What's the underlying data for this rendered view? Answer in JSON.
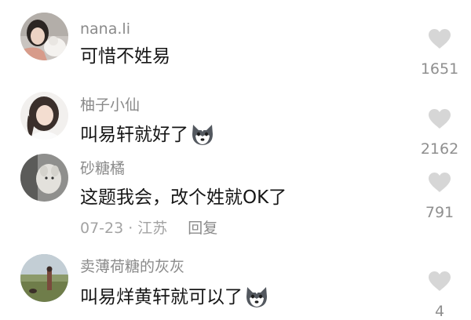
{
  "comments": [
    {
      "username": "nana.li",
      "text": "可惜不姓易",
      "likes": "1651",
      "avatar": "girl-with-cat-avatar"
    },
    {
      "username": "柚子小仙",
      "text": "叫易轩就好了",
      "likes": "2162",
      "avatar": "girl-portrait-avatar",
      "emoji": "husky-dog-emoji"
    },
    {
      "username": "砂糖橘",
      "text": "这题我会，改个姓就OK了",
      "likes": "791",
      "avatar": "plush-toy-avatar",
      "date": "07-23",
      "location": "江苏",
      "reply_label": "回复"
    },
    {
      "username": "卖薄荷糖的灰灰",
      "text": "叫易烊黄轩就可以了",
      "likes": "4",
      "avatar": "outdoor-scene-avatar",
      "emoji": "husky-dog-emoji"
    }
  ],
  "colors": {
    "username": "#8a8a8a",
    "text": "#161616",
    "meta": "#a3a3a3",
    "heart": "#d6d6d6"
  }
}
